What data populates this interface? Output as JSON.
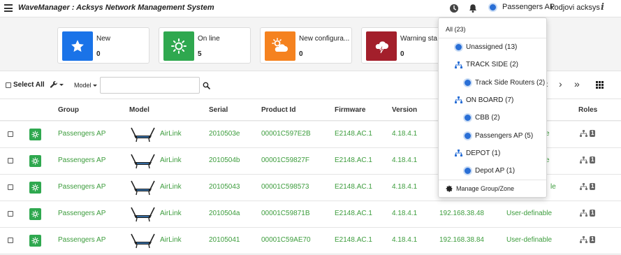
{
  "header": {
    "title": "WaveManager : Acksys Network Management System",
    "group_selector": "Passengers AP",
    "username": "kodjovi acksys",
    "info": "i"
  },
  "tiles": [
    {
      "label": "New",
      "count": "0",
      "color": "#1a73e8",
      "icon": "star-icon"
    },
    {
      "label": "On line",
      "count": "5",
      "color": "#2fa84f",
      "icon": "sun-icon"
    },
    {
      "label": "New configura...",
      "count": "0",
      "color": "#f5821f",
      "icon": "cloud-sun-icon"
    },
    {
      "label": "Warning sta",
      "count": "0",
      "color": "#a31f2b",
      "icon": "lightning-icon"
    }
  ],
  "toolbar": {
    "select_all": "Select All",
    "model_filter": "Model",
    "pager_prev": "‹",
    "pager_next": "›",
    "pager_last": "»"
  },
  "table": {
    "columns": [
      "Group",
      "Model",
      "Serial",
      "Product Id",
      "Firmware",
      "Version",
      "Roles"
    ],
    "rows": [
      {
        "group": "Passengers AP",
        "model": "AirLink",
        "serial": "2010503e",
        "product_id": "00001C597E2B",
        "firmware": "E2148.AC.1",
        "version": "4.18.4.1",
        "ip": "",
        "config": "definable",
        "role_count": "1"
      },
      {
        "group": "Passengers AP",
        "model": "AirLink",
        "serial": "2010504b",
        "product_id": "00001C59827F",
        "firmware": "E2148.AC.1",
        "version": "4.18.4.1",
        "ip": "",
        "config": "definable",
        "role_count": "1"
      },
      {
        "group": "Passengers AP",
        "model": "AirLink",
        "serial": "20105043",
        "product_id": "00001C598573",
        "firmware": "E2148.AC.1",
        "version": "4.18.4.1",
        "ip": "",
        "config": "le",
        "role_count": "1"
      },
      {
        "group": "Passengers AP",
        "model": "AirLink",
        "serial": "2010504a",
        "product_id": "00001C59871B",
        "firmware": "E2148.AC.1",
        "version": "4.18.4.1",
        "ip": "192.168.38.48",
        "config": "User-definable",
        "role_count": "1"
      },
      {
        "group": "Passengers AP",
        "model": "AirLink",
        "serial": "20105041",
        "product_id": "00001C59AE70",
        "firmware": "E2148.AC.1",
        "version": "4.18.4.1",
        "ip": "192.168.38.84",
        "config": "User-definable",
        "role_count": "1"
      }
    ]
  },
  "dropdown": {
    "all": "All (23)",
    "items": [
      {
        "label": "Unassigned (13)",
        "icon": "dot-icon",
        "level": 0
      },
      {
        "label": "TRACK SIDE (2)",
        "icon": "hierarchy-icon",
        "level": 0
      },
      {
        "label": "Track Side Routers (2)",
        "icon": "dot-icon",
        "level": 1
      },
      {
        "label": "ON BOARD (7)",
        "icon": "hierarchy-icon",
        "level": 0
      },
      {
        "label": "CBB (2)",
        "icon": "dot-icon",
        "level": 1
      },
      {
        "label": "Passengers AP (5)",
        "icon": "dot-icon",
        "level": 1
      },
      {
        "label": "DEPOT (1)",
        "icon": "hierarchy-icon",
        "level": 0
      },
      {
        "label": "Depot AP (1)",
        "icon": "dot-icon",
        "level": 1
      }
    ],
    "manage": "Manage Group/Zone"
  },
  "colors": {
    "accent_green": "#3c9c3c",
    "status_green": "#2fa84f",
    "group_icon_blue": "#2a6fd6"
  }
}
